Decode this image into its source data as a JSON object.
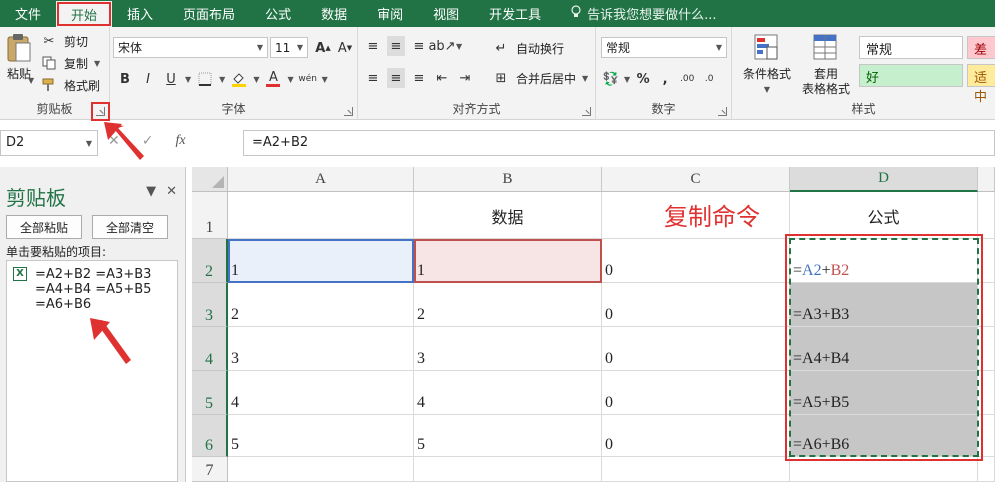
{
  "menu": {
    "tabs": [
      "文件",
      "开始",
      "插入",
      "页面布局",
      "公式",
      "数据",
      "审阅",
      "视图",
      "开发工具"
    ],
    "active_tab": "开始",
    "tell_me": "告诉我您想要做什么..."
  },
  "ribbon": {
    "clipboard": {
      "label": "剪贴板",
      "paste": "粘贴",
      "cut": "剪切",
      "copy": "复制",
      "format_painter": "格式刷"
    },
    "font": {
      "label": "字体",
      "name": "宋体",
      "size": "11"
    },
    "alignment": {
      "label": "对齐方式",
      "wrap_text": "自动换行",
      "merge_center": "合并后居中"
    },
    "number": {
      "label": "数字",
      "format": "常规"
    },
    "styles": {
      "label": "样式",
      "conditional_format": "条件格式",
      "table_format_line1": "套用",
      "table_format_line2": "表格格式",
      "normal": "常规",
      "bad": "差",
      "good": "好",
      "neutral": "适中"
    }
  },
  "formula_bar": {
    "name_box": "D2",
    "fx": "fx",
    "formula": "=A2+B2"
  },
  "clipboard_pane": {
    "title": "剪贴板",
    "paste_all": "全部粘贴",
    "clear_all": "全部清空",
    "instruction": "单击要粘贴的项目:",
    "item_text": "=A2+B2 =A3+B3\n=A4+B4 =A5+B5\n=A6+B6"
  },
  "grid": {
    "columns": [
      "A",
      "B",
      "C",
      "D"
    ],
    "rows": [
      "1",
      "2",
      "3",
      "4",
      "5",
      "6",
      "7"
    ],
    "cells": {
      "B1": "数据",
      "D1": "公式",
      "A2": "1",
      "B2": "1",
      "C2": "0",
      "A3": "2",
      "B3": "2",
      "C3": "0",
      "D3": "=A3+B3",
      "A4": "3",
      "B4": "3",
      "C4": "0",
      "D4": "=A4+B4",
      "A5": "4",
      "B5": "4",
      "C5": "0",
      "D5": "=A5+B5",
      "A6": "5",
      "B6": "5",
      "C6": "0",
      "D6": "=A6+B6"
    },
    "d2_parts": {
      "eq": "=",
      "ref1": "A2",
      "op": "+",
      "ref2": "B2"
    }
  },
  "annotation": {
    "text": "复制命令"
  },
  "colors": {
    "excel_green": "#217346",
    "annotation_red": "#e03131",
    "ref_blue": "#4472c4",
    "ref_red": "#c0504d"
  }
}
